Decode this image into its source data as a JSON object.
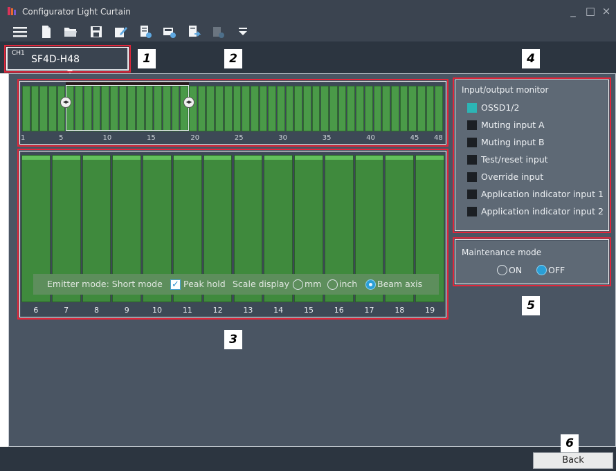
{
  "window": {
    "title": "Configurator Light Curtain",
    "controls": [
      "_",
      "□",
      "×"
    ]
  },
  "toolbar": {
    "icons": [
      "menu-icon",
      "new-file-icon",
      "open-folder-icon",
      "save-icon",
      "edit-icon",
      "report-icon",
      "device-info-icon",
      "export-icon",
      "disabled-tool-icon",
      "dropdown-arrow-icon"
    ]
  },
  "channel_tab": {
    "channel": "CH1",
    "model": "SF4D-H48"
  },
  "callouts": [
    "1",
    "2",
    "3",
    "4",
    "5",
    "6"
  ],
  "overview": {
    "beam_count": 48,
    "ticks": [
      "1",
      "5",
      "10",
      "15",
      "20",
      "25",
      "30",
      "35",
      "40",
      "45",
      "48"
    ],
    "window_start_beam": 6,
    "window_end_beam": 19
  },
  "beam_view": {
    "beams": [
      "6",
      "7",
      "8",
      "9",
      "10",
      "11",
      "12",
      "13",
      "14",
      "15",
      "16",
      "17",
      "18",
      "19"
    ],
    "emitter_mode_label": "Emitter mode: Short mode",
    "peak_hold_label": "Peak hold",
    "peak_hold_checked": true,
    "scale_display_label": "Scale display",
    "scale_options": [
      "mm",
      "inch",
      "Beam axis"
    ],
    "scale_selected": "Beam axis"
  },
  "io_monitor": {
    "title": "Input/output monitor",
    "items": [
      {
        "label": "OSSD1/2",
        "active": true
      },
      {
        "label": "Muting input A",
        "active": false
      },
      {
        "label": "Muting input B",
        "active": false
      },
      {
        "label": "Test/reset input",
        "active": false
      },
      {
        "label": "Override input",
        "active": false
      },
      {
        "label": "Application indicator input 1",
        "active": false
      },
      {
        "label": "Application indicator input 2",
        "active": false
      }
    ]
  },
  "maintenance": {
    "title": "Maintenance mode",
    "on_label": "ON",
    "off_label": "OFF",
    "selected": "OFF"
  },
  "footer": {
    "back_label": "Back"
  },
  "colors": {
    "beam_green": "#3f8a3d",
    "highlight_red": "#e0263a",
    "osd_active": "#2cb5b5",
    "radio_selected": "#2a9fd6"
  }
}
